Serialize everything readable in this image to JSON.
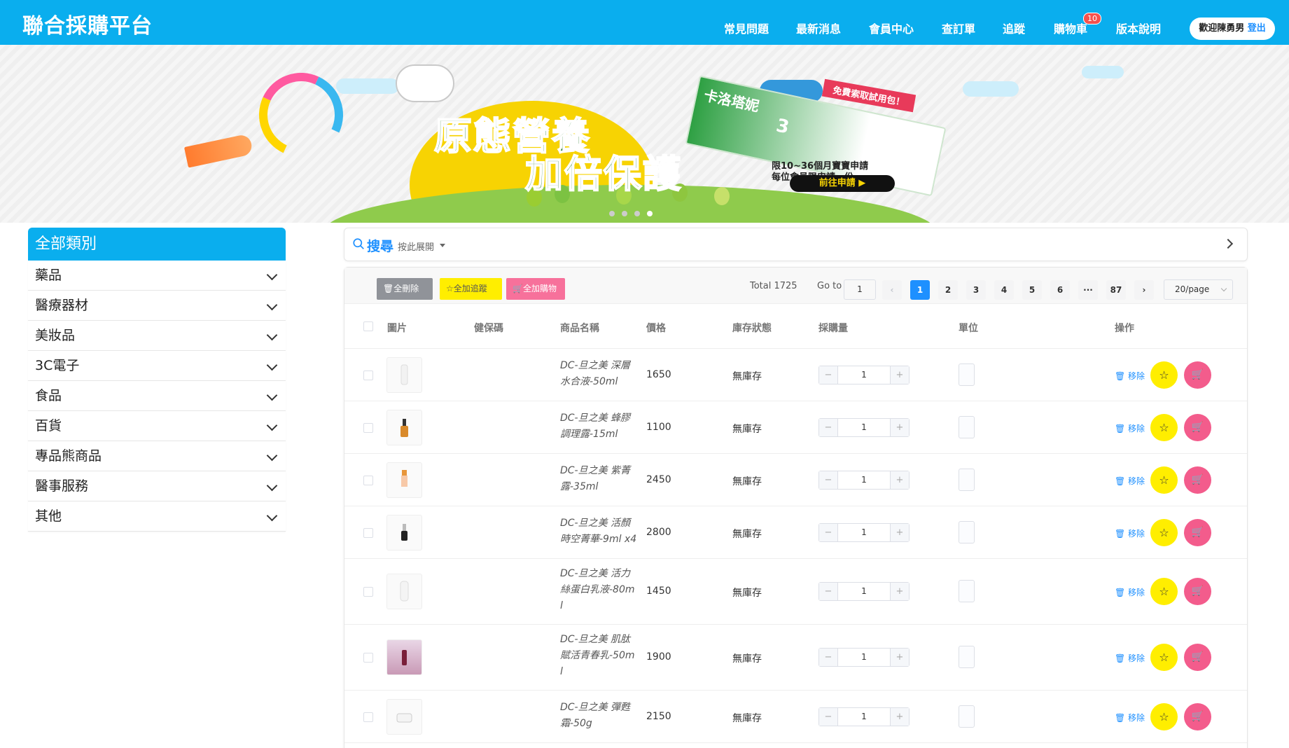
{
  "header": {
    "brand": "聯合採購平台",
    "nav": [
      "常見問題",
      "最新消息",
      "會員中心",
      "查訂單",
      "追蹤",
      "購物車",
      "版本說明"
    ],
    "cart_count": "10",
    "welcome": "歡迎陳勇男",
    "logout": "登出",
    "bg_color": "#0aaeee"
  },
  "banner": {
    "headline1": "原態營養",
    "headline2": "加倍保護",
    "ribbon": "免費索取試用包！",
    "sub1": "限10~36個月寶寶申請",
    "sub2": "每位會員限申請一份",
    "cta": "前往申請 ▶",
    "pack_brand": "卡洛塔妮",
    "pack_num": "3"
  },
  "sidebar": {
    "title": "全部類別",
    "items": [
      "藥品",
      "醫療器材",
      "美妝品",
      "3C電子",
      "食品",
      "百貨",
      "專品熊商品",
      "醫事服務",
      "其他"
    ]
  },
  "search": {
    "label": "搜尋",
    "sub": "按此展開"
  },
  "toolbar": {
    "delete_all": "🗑全刪除",
    "track_all": "☆全加追蹤",
    "cart_all": "🛒全加購物"
  },
  "pagination": {
    "total": "Total 1725",
    "goto_label": "Go to",
    "goto_value": "1",
    "pages": [
      "1",
      "2",
      "3",
      "4",
      "5",
      "6",
      "···",
      "87"
    ],
    "current": "1",
    "page_size": "20/page"
  },
  "table": {
    "headers": {
      "image": "圖片",
      "nhi_code": "健保碼",
      "name": "商品名稱",
      "price": "價格",
      "stock": "庫存狀態",
      "qty": "採購量",
      "unit": "單位",
      "action": "操作"
    },
    "remove_label": "🗑 移除",
    "rows": [
      {
        "name": "DC-旦之美 深層水合液-50ml",
        "price": "1650",
        "stock": "無庫存",
        "qty": "1"
      },
      {
        "name": "DC-旦之美 蜂膠調理露-15ml",
        "price": "1100",
        "stock": "無庫存",
        "qty": "1"
      },
      {
        "name": "DC-旦之美 紫菁露-35ml",
        "price": "2450",
        "stock": "無庫存",
        "qty": "1"
      },
      {
        "name": "DC-旦之美 活顏時空菁華-9ml x4",
        "price": "2800",
        "stock": "無庫存",
        "qty": "1"
      },
      {
        "name": "DC-旦之美 活力絲蛋白乳液-80ml",
        "price": "1450",
        "stock": "無庫存",
        "qty": "1"
      },
      {
        "name": "DC-旦之美 肌肽賦活青春乳-50ml",
        "price": "1900",
        "stock": "無庫存",
        "qty": "1"
      },
      {
        "name": "DC-旦之美 彈甦霜-50g",
        "price": "2150",
        "stock": "無庫存",
        "qty": "1"
      }
    ]
  }
}
